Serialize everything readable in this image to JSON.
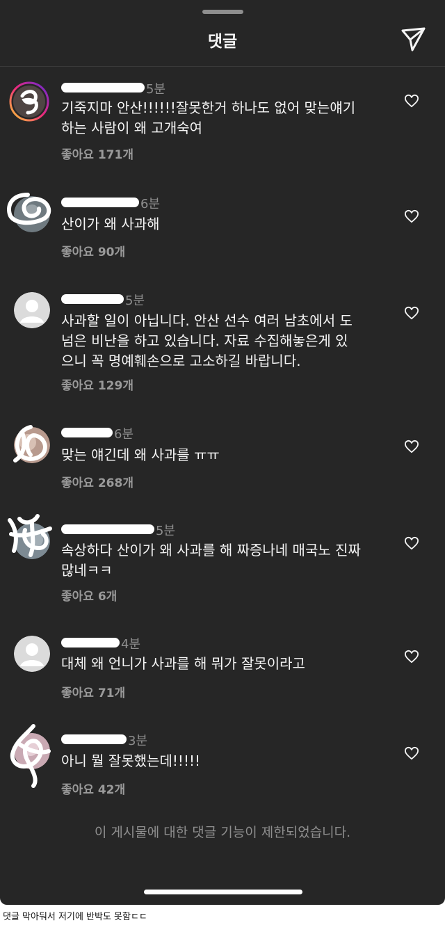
{
  "header": {
    "title": "댓글",
    "share_icon": "paper-plane-icon"
  },
  "comments": [
    {
      "time": "5분",
      "text": "기죽지마 안산!!!!!!잘못한거 하나도 없어 맞는얘기\n하는 사람이 왜 고개숙여",
      "likes": "좋아요 171개"
    },
    {
      "time": "6분",
      "text": "산이가 왜 사과해",
      "likes": "좋아요 90개"
    },
    {
      "time": "5분",
      "text": "사과할 일이 아닙니다. 안산 선수 여러 남초에서 도\n넘은 비난을 하고 있습니다. 자료 수집해놓은게 있\n으니 꼭 명예훼손으로 고소하길 바랍니다.",
      "likes": "좋아요 129개"
    },
    {
      "time": "6분",
      "text": "맞는 얘긴데 왜 사과를 ㅠㅠ",
      "likes": "좋아요 268개"
    },
    {
      "time": "5분",
      "text": "속상하다 산이가 왜 사과를 해 짜증나네 매국노 진짜\n많네ㅋㅋ",
      "likes": "좋아요 6개"
    },
    {
      "time": "4분",
      "text": "대체 왜 언니가 사과를 해 뭐가 잘못이라고",
      "likes": "좋아요 71개"
    },
    {
      "time": "3분",
      "text": "아니 뭘 잘못했는데!!!!!",
      "likes": "좋아요 42개"
    }
  ],
  "footer": {
    "restricted_notice": "이 게시물에 대한 댓글 기능이 제한되었습니다."
  },
  "caption": "댓글 막아둬서 저기에 반박도 못함ㄷㄷ",
  "colors": {
    "background": "#262626",
    "text_primary": "#f5f5f5",
    "text_secondary": "#8e8e8e",
    "avatar_ring_gradient": [
      "#f9ce34",
      "#ee2a7b",
      "#6228d7"
    ]
  }
}
